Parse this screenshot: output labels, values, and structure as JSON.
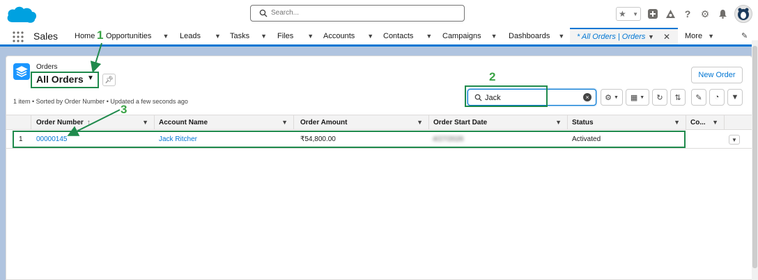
{
  "header": {
    "search_placeholder": "Search...",
    "icons": [
      "favorites-star-icon",
      "chevron-down-icon",
      "add-icon",
      "trailhead-icon",
      "help-icon",
      "setup-gear-icon",
      "notification-bell-icon",
      "avatar"
    ]
  },
  "nav": {
    "app_name": "Sales",
    "items": [
      {
        "label": "Home"
      },
      {
        "label": "Opportunities"
      },
      {
        "label": "Leads"
      },
      {
        "label": "Tasks"
      },
      {
        "label": "Files"
      },
      {
        "label": "Accounts"
      },
      {
        "label": "Contacts"
      },
      {
        "label": "Campaigns"
      },
      {
        "label": "Dashboards"
      }
    ],
    "active_tab": "* All Orders | Orders",
    "more": "More"
  },
  "list": {
    "object": "Orders",
    "view_name": "All Orders",
    "meta": "1 item • Sorted by Order Number • Updated a few seconds ago",
    "new_button": "New Order",
    "search_value": "Jack",
    "columns": [
      "Order Number",
      "Account Name",
      "Order Amount",
      "Order Start Date",
      "Status",
      "Co..."
    ],
    "sort_indicator": "↑",
    "rows": [
      {
        "index": "1",
        "order_number": "00000145",
        "account": "Jack Ritcher",
        "amount": "₹54,800.00",
        "start_date": "4/27/2026",
        "status": "Activated"
      }
    ]
  },
  "annotations": {
    "step1": "1",
    "step2": "2",
    "step3": "3",
    "color": "#3aa346"
  }
}
